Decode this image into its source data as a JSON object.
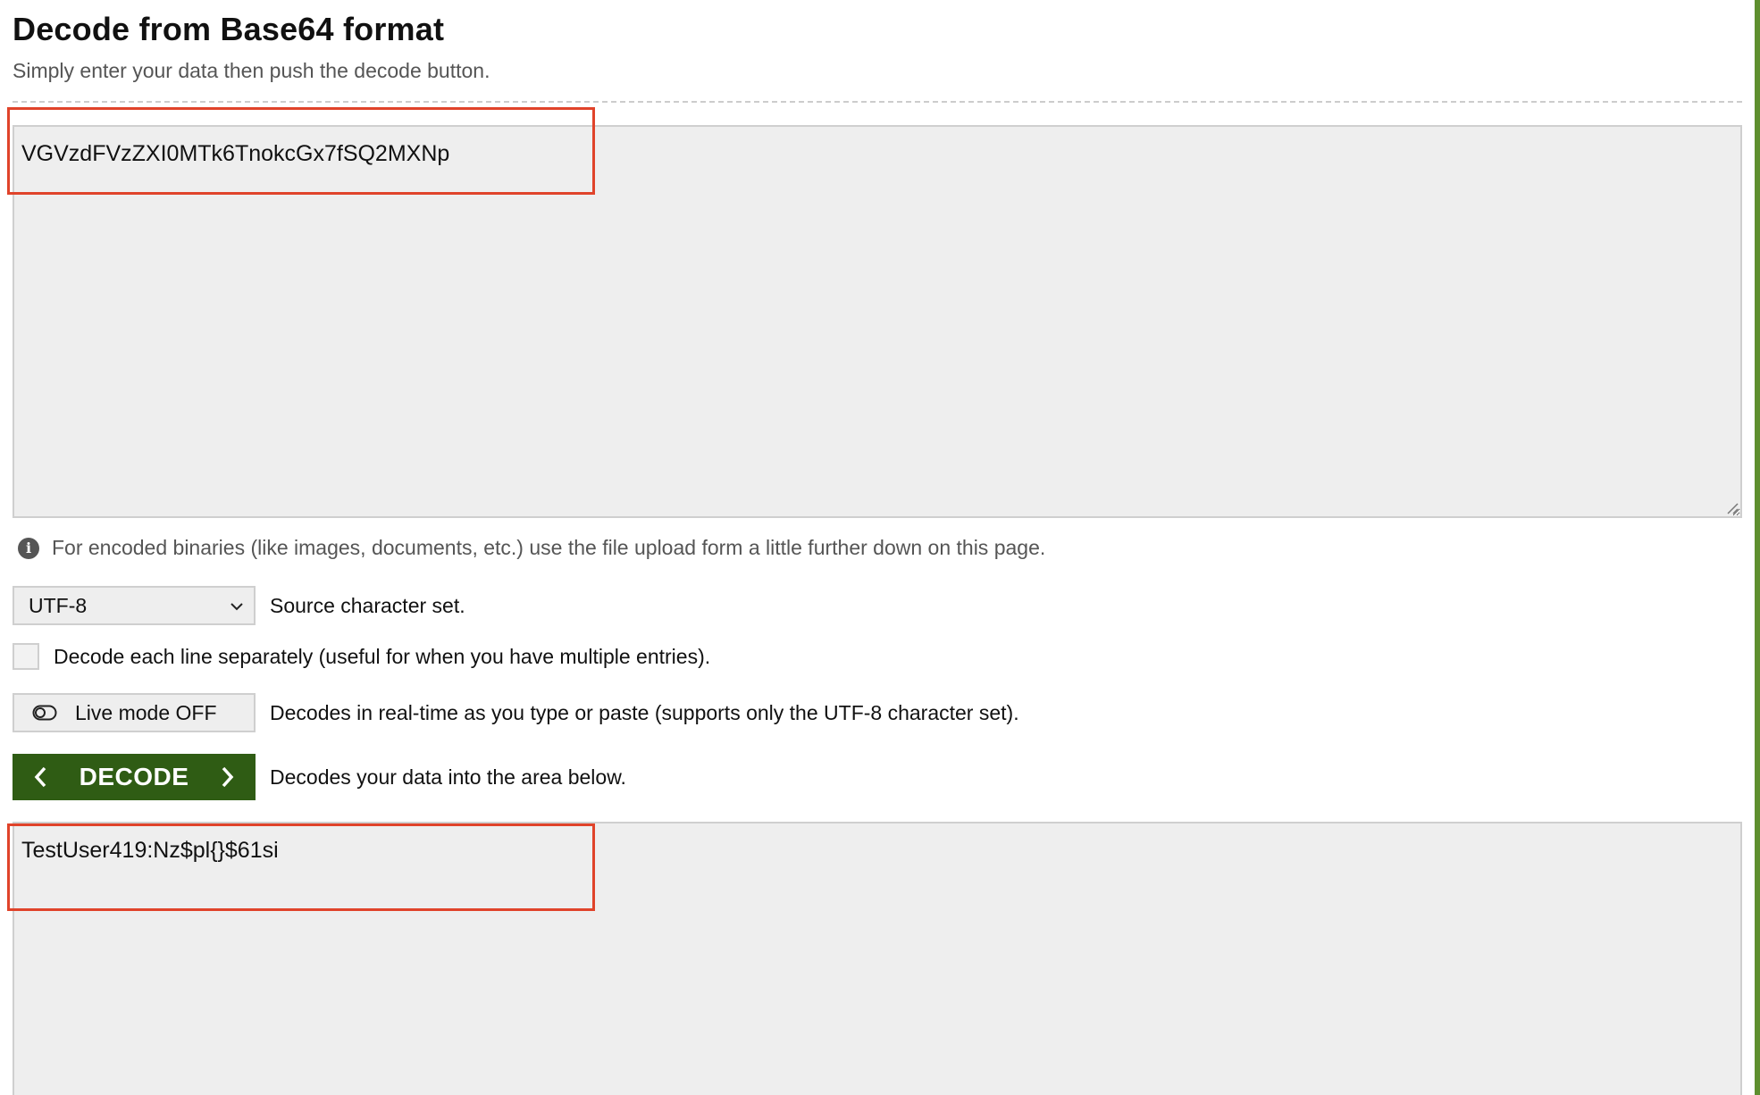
{
  "header": {
    "title": "Decode from Base64 format",
    "subtitle": "Simply enter your data then push the decode button."
  },
  "input": {
    "value": "VGVzdFVzZXI0MTk6TnokcGx7fSQ2MXNp"
  },
  "info": {
    "text": "For encoded binaries (like images, documents, etc.) use the file upload form a little further down on this page.",
    "icon": "info-icon"
  },
  "charset": {
    "selected": "UTF-8",
    "description": "Source character set."
  },
  "lines": {
    "label": "Decode each line separately (useful for when you have multiple entries).",
    "checked": false
  },
  "live": {
    "label": "Live mode OFF",
    "description": "Decodes in real-time as you type or paste (supports only the UTF-8 character set)."
  },
  "decode": {
    "label": "DECODE",
    "description": "Decodes your data into the area below."
  },
  "output": {
    "value": "TestUser419:Nz$pl{}$61si"
  },
  "colors": {
    "accent": "#2f5c14",
    "highlight": "#e0432a",
    "field_bg": "#eeeeee"
  }
}
